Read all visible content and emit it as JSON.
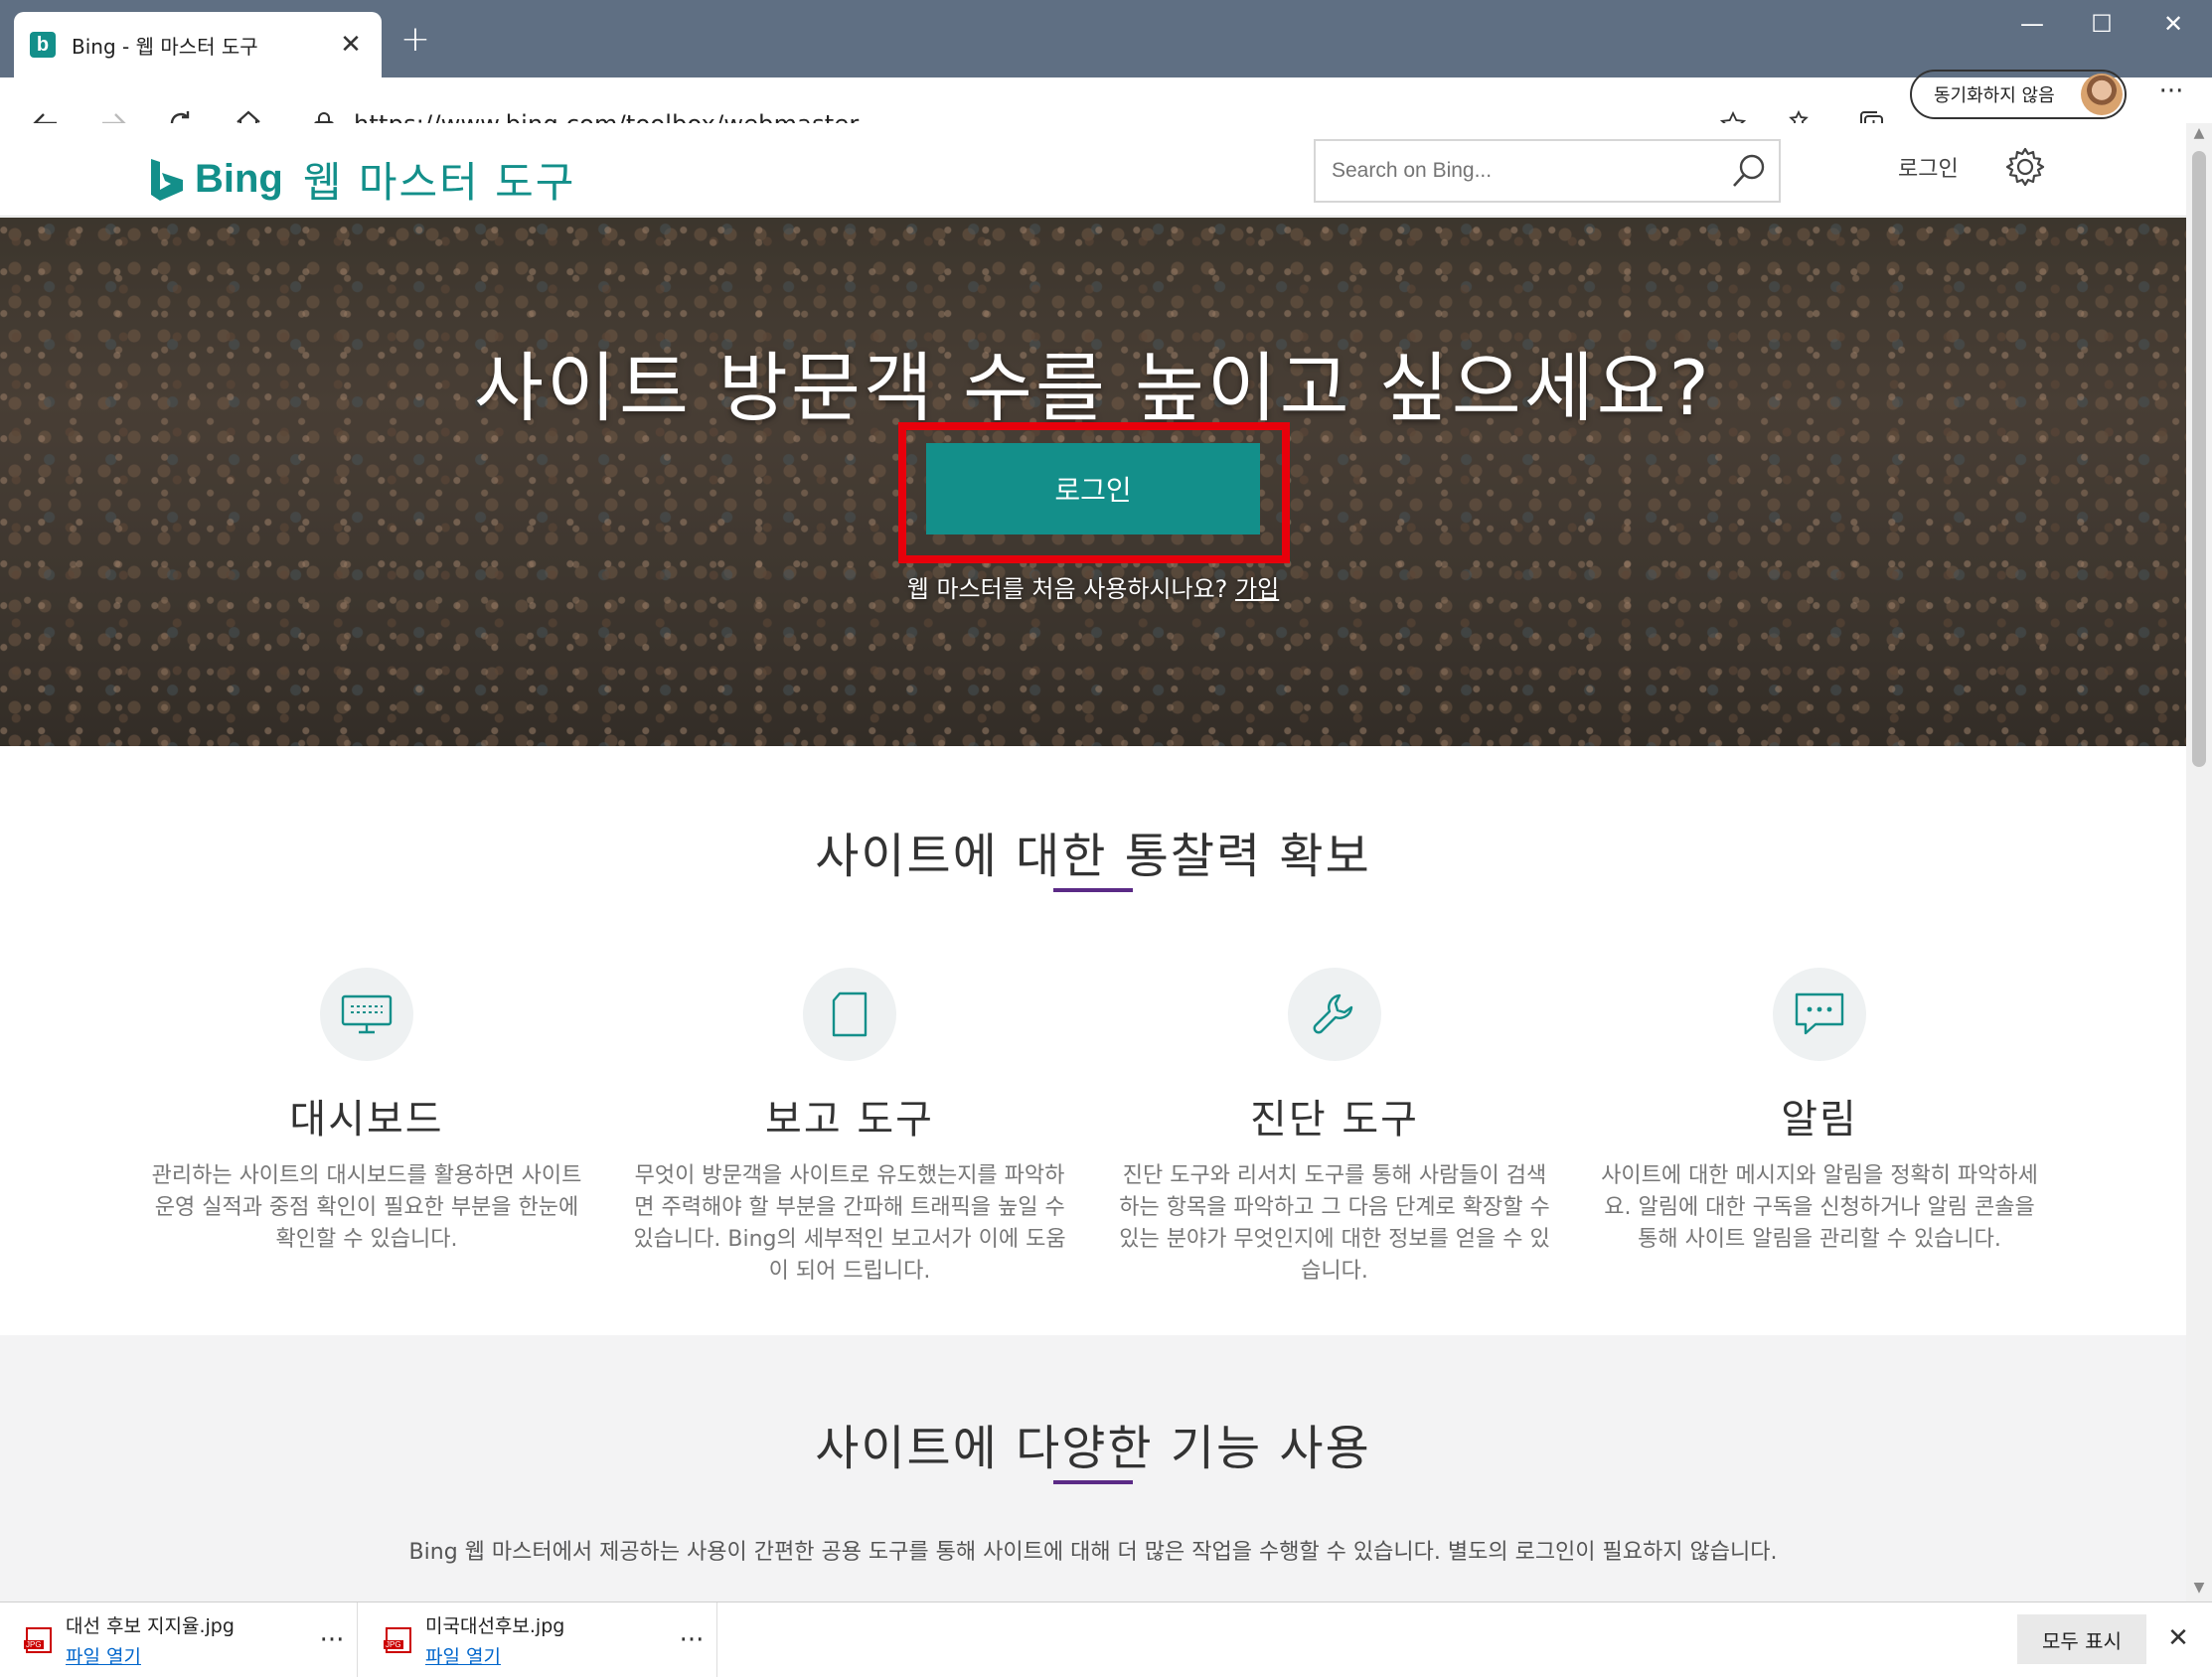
{
  "browser": {
    "tab_title": "Bing - 웹 마스터 도구",
    "new_tab": "+",
    "address": "https://www.bing.com/toolbox/webmaster",
    "sync_label": "동기화하지 않음",
    "more": "···"
  },
  "site": {
    "brand": "Bing",
    "title": "웹 마스터 도구",
    "search_placeholder": "Search on Bing...",
    "header_login": "로그인"
  },
  "hero": {
    "title": "사이트 방문객 수를 높이고 싶으세요?",
    "login_button": "로그인",
    "signup_prompt": "웹 마스터를 처음 사용하시나요?",
    "signup_link": "가입"
  },
  "insights": {
    "title": "사이트에 대한 통찰력 확보",
    "features": [
      {
        "icon": "monitor-icon",
        "title": "대시보드",
        "desc": "관리하는 사이트의 대시보드를 활용하면 사이트 운영 실적과 중점 확인이 필요한 부분을 한눈에 확인할 수 있습니다."
      },
      {
        "icon": "document-icon",
        "title": "보고 도구",
        "desc": "무엇이 방문객을 사이트로 유도했는지를 파악하면 주력해야 할 부분을 간파해 트래픽을 높일 수 있습니다. Bing의 세부적인 보고서가 이에 도움이 되어 드립니다."
      },
      {
        "icon": "wrench-icon",
        "title": "진단 도구",
        "desc": "진단 도구와 리서치 도구를 통해 사람들이 검색하는 항목을 파악하고 그 다음 단계로 확장할 수 있는 분야가 무엇인지에 대한 정보를 얻을 수 있습니다."
      },
      {
        "icon": "chat-icon",
        "title": "알림",
        "desc": "사이트에 대한 메시지와 알림을 정확히 파악하세요. 알림에 대한 구독을 신청하거나 알림 콘솔을 통해 사이트 알림을 관리할 수 있습니다."
      }
    ]
  },
  "features_section": {
    "title": "사이트에 다양한 기능 사용",
    "desc": "Bing 웹 마스터에서 제공하는 사용이 간편한 공용 도구를 통해 사이트에 대해 더 많은 작업을 수행할 수 있습니다. 별도의 로그인이 필요하지 않습니다."
  },
  "downloads": {
    "items": [
      {
        "name": "대선 후보 지지율.jpg",
        "action": "파일 열기",
        "badge": "JPG"
      },
      {
        "name": "미국대선후보.jpg",
        "action": "파일 열기",
        "badge": "JPG"
      }
    ],
    "more": "···",
    "show_all": "모두 표시",
    "close": "✕"
  },
  "colors": {
    "brand_teal": "#138f8a",
    "accent_purple": "#5b2a86",
    "highlight_red": "#e8000b",
    "titlebar": "#5f6f83"
  }
}
